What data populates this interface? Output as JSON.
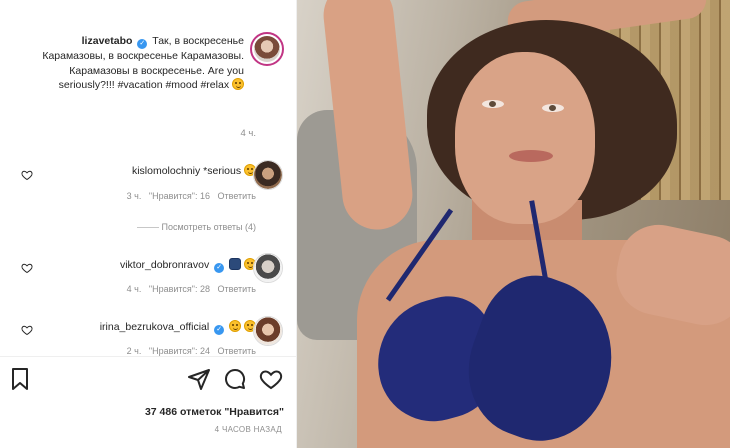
{
  "caption": {
    "username": "lizavetabo",
    "text": "Так, в воскресенье Карамазовы, в воскресенье Карамазовы. Карамазовы в воскресенье. Are you seriously?!!! #vacation #mood #relax",
    "time": "4 ч."
  },
  "comments": [
    {
      "username": "kislomolochniy",
      "text": "*serious",
      "time": "3 ч.",
      "likes": "\"Нравится\": 16",
      "reply": "Ответить"
    },
    {
      "username": "viktor_dobronravov",
      "text": "",
      "time": "4 ч.",
      "likes": "\"Нравится\": 28",
      "reply": "Ответить"
    },
    {
      "username": "irina_bezrukova_official",
      "text": "",
      "time": "2 ч.",
      "likes": "\"Нравится\": 24",
      "reply": "Ответить"
    }
  ],
  "view_replies": "Посмотреть ответы (4)",
  "footer": {
    "likes": "37 486 отметок \"Нравится\"",
    "posted": "4 ЧАСОВ НАЗАД"
  },
  "icons": {
    "bookmark": "bookmark-icon",
    "share": "share-icon",
    "comment": "comment-icon",
    "like": "heart-icon"
  }
}
